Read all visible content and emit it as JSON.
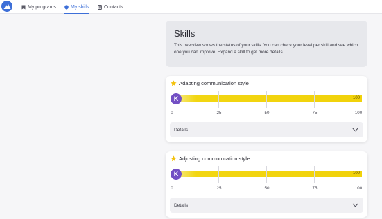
{
  "nav": {
    "items": [
      {
        "label": "My programs",
        "icon": "bookmark-icon"
      },
      {
        "label": "My skills",
        "icon": "shield-icon",
        "active": true
      },
      {
        "label": "Contacts",
        "icon": "contacts-icon"
      }
    ]
  },
  "intro": {
    "title": "Skills",
    "text": "This overview shows the status of your skills. You can check your level per skill and see which one you can improve. Expand a skill to get more details."
  },
  "skills": [
    {
      "name": "Adapting communication style",
      "level_letter": "K",
      "value": 100,
      "value_label": "100",
      "details_label": "Details"
    },
    {
      "name": "Adjusting communication style",
      "level_letter": "K",
      "value": 100,
      "value_label": "100",
      "details_label": "Details"
    }
  ],
  "axis_ticks": [
    "0",
    "25",
    "50",
    "75",
    "100"
  ],
  "colors": {
    "accent": "#3d6fd8",
    "bar": "#f1d20a",
    "badge": "#7350c4",
    "star": "#f4c20d"
  }
}
